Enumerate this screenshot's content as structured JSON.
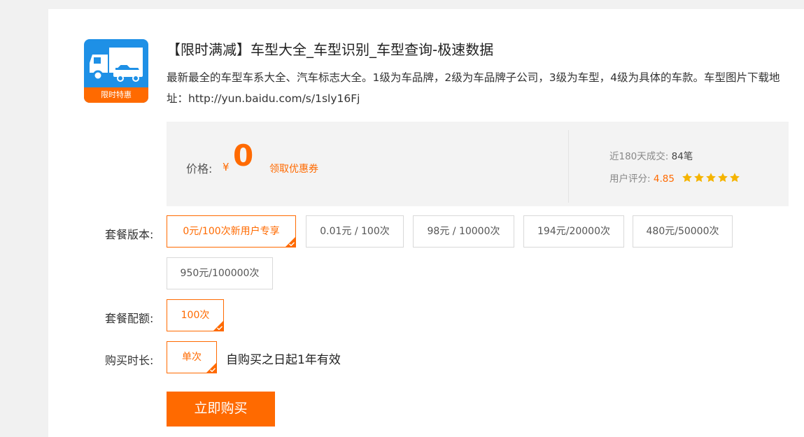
{
  "product": {
    "title": "【限时满减】车型大全_车型识别_车型查询-极速数据",
    "description": "最新最全的车型车系大全、汽车标志大全。1级为车品牌，2级为车品牌子公司，3级为车型，4级为具体的车款。车型图片下载地址：http://yun.baidu.com/s/1sly16Fj",
    "logo_ribbon": "限时特惠"
  },
  "price": {
    "label": "价格:",
    "currency": "¥",
    "value": "0",
    "coupon_link": "领取优惠券"
  },
  "stats": {
    "deals_label": "近180天成交:",
    "deals_value": "84笔",
    "rating_label": "用户评分:",
    "rating_value": "4.85",
    "stars": 5
  },
  "package_version": {
    "label": "套餐版本:",
    "options": [
      {
        "label": "0元/100次新用户专享",
        "selected": true
      },
      {
        "label": "0.01元 / 100次",
        "selected": false
      },
      {
        "label": "98元 / 10000次",
        "selected": false
      },
      {
        "label": "194元/20000次",
        "selected": false
      },
      {
        "label": "480元/50000次",
        "selected": false
      },
      {
        "label": "950元/100000次",
        "selected": false
      }
    ]
  },
  "package_quota": {
    "label": "套餐配额:",
    "options": [
      {
        "label": "100次",
        "selected": true
      }
    ]
  },
  "purchase_duration": {
    "label": "购买时长:",
    "options": [
      {
        "label": "单次",
        "selected": true
      }
    ],
    "validity_text": "自购买之日起1年有效"
  },
  "buy_button": "立即购买",
  "colors": {
    "accent": "#ff6a00",
    "logo_blue": "#1e90e6",
    "panel_bg": "#f3f3f3",
    "star": "#f5b400"
  }
}
